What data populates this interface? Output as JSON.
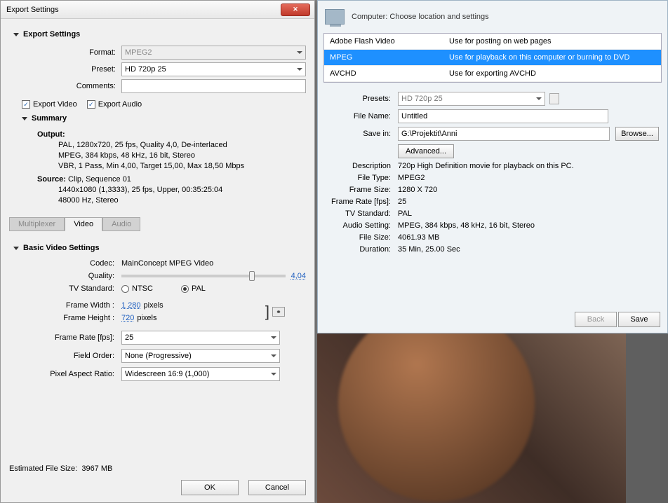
{
  "left_dialog": {
    "title": "Export Settings",
    "section_export": "Export Settings",
    "format_label": "Format:",
    "format_value": "MPEG2",
    "preset_label": "Preset:",
    "preset_value": "HD 720p 25",
    "comments_label": "Comments:",
    "comments_value": "",
    "export_video": "Export Video",
    "export_audio": "Export Audio",
    "summary_head": "Summary",
    "output_label": "Output:",
    "output_line1": "PAL, 1280x720, 25 fps, Quality 4,0, De-interlaced",
    "output_line2": "MPEG, 384 kbps, 48 kHz, 16 bit, Stereo",
    "output_line3": "VBR, 1 Pass, Min 4,00, Target 15,00, Max 18,50 Mbps",
    "source_label": "Source:",
    "source_line1": "Clip, Sequence 01",
    "source_line2": "1440x1080 (1,3333), 25 fps, Upper, 00:35:25:04",
    "source_line3": "48000 Hz, Stereo",
    "tab_multiplexer": "Multiplexer",
    "tab_video": "Video",
    "tab_audio": "Audio",
    "basic_head": "Basic Video Settings",
    "codec_label": "Codec:",
    "codec_value": "MainConcept MPEG Video",
    "quality_label": "Quality:",
    "quality_value": "4,04",
    "tvstd_label": "TV Standard:",
    "ntsc": "NTSC",
    "pal": "PAL",
    "framew_label": "Frame Width :",
    "framew_value": "1 280",
    "frameh_label": "Frame Height :",
    "frameh_value": "720",
    "pixels": "pixels",
    "framerate_label": "Frame Rate [fps]:",
    "framerate_value": "25",
    "fieldorder_label": "Field Order:",
    "fieldorder_value": "None (Progressive)",
    "par_label": "Pixel Aspect Ratio:",
    "par_value": "Widescreen 16:9 (1,000)",
    "est_label": "Estimated File Size:",
    "est_value": "3967 MB",
    "ok": "OK",
    "cancel": "Cancel"
  },
  "right_panel": {
    "header": "Computer: Choose location and settings",
    "formats": [
      {
        "name": "Adobe Flash Video",
        "desc": "Use for posting on web pages"
      },
      {
        "name": "MPEG",
        "desc": "Use for playback on this computer or burning to DVD"
      },
      {
        "name": "AVCHD",
        "desc": "Use for exporting AVCHD"
      }
    ],
    "presets_label": "Presets:",
    "presets_value": "HD 720p 25",
    "filename_label": "File Name:",
    "filename_value": "Untitled",
    "savein_label": "Save in:",
    "savein_value": "G:\\Projektit\\Anni",
    "browse": "Browse...",
    "advanced": "Advanced...",
    "desc_label": "Description",
    "desc_value": "720p High Definition movie for playback on this PC.",
    "filetype_label": "File Type:",
    "filetype_value": "MPEG2",
    "framesize_label": "Frame Size:",
    "framesize_value": "1280 X 720",
    "framerate_label": "Frame Rate [fps]:",
    "framerate_value": "25",
    "tvstd_label": "TV Standard:",
    "tvstd_value": "PAL",
    "audio_label": "Audio Setting:",
    "audio_value": "MPEG, 384 kbps, 48 kHz, 16 bit, Stereo",
    "filesize_label": "File Size:",
    "filesize_value": "4061.93 MB",
    "duration_label": "Duration:",
    "duration_value": "35 Min, 25.00 Sec",
    "back": "Back",
    "save": "Save"
  }
}
